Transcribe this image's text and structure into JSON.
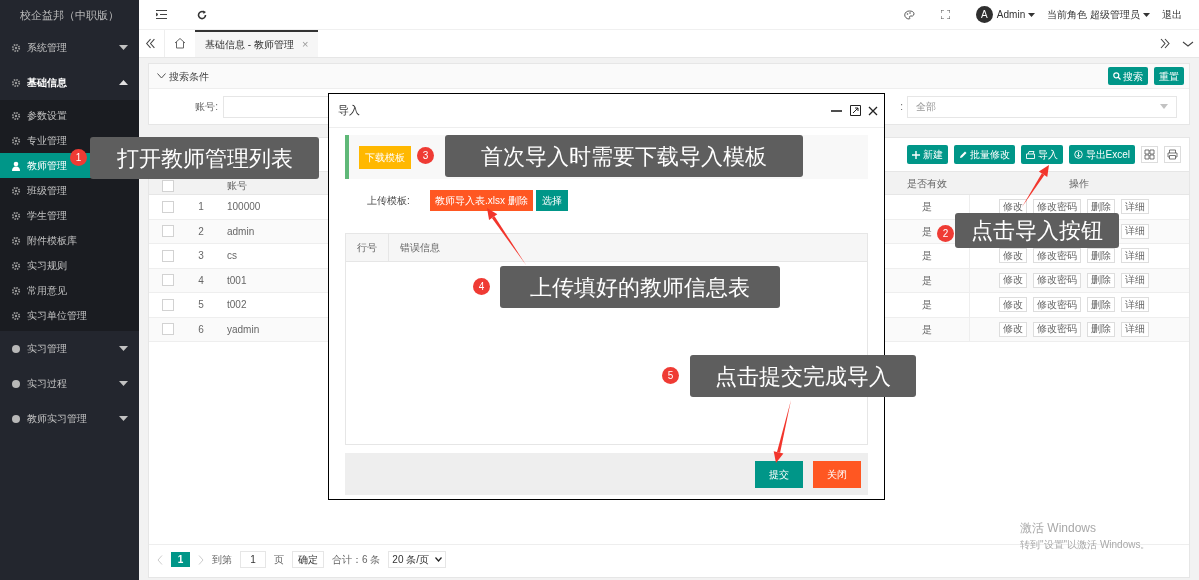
{
  "sidebar": {
    "title": "校企益邦（中职版）",
    "items": [
      {
        "label": "系统管理",
        "kind": "gear",
        "expanded": false
      },
      {
        "label": "基础信息",
        "kind": "gear",
        "expanded": true,
        "children": [
          {
            "label": "参数设置",
            "kind": "gear",
            "selected": false
          },
          {
            "label": "专业管理",
            "kind": "gear",
            "selected": false
          },
          {
            "label": "教师管理",
            "kind": "user",
            "selected": true
          },
          {
            "label": "班级管理",
            "kind": "gear",
            "selected": false
          },
          {
            "label": "学生管理",
            "kind": "gear",
            "selected": false
          },
          {
            "label": "附件模板库",
            "kind": "gear",
            "selected": false
          },
          {
            "label": "实习规则",
            "kind": "gear",
            "selected": false
          },
          {
            "label": "常用意见",
            "kind": "gear",
            "selected": false
          },
          {
            "label": "实习单位管理",
            "kind": "gear",
            "selected": false
          }
        ]
      },
      {
        "label": "实习管理",
        "kind": "dot",
        "expanded": false
      },
      {
        "label": "实习过程",
        "kind": "dot",
        "expanded": false
      },
      {
        "label": "教师实习管理",
        "kind": "dot",
        "expanded": false
      }
    ]
  },
  "top_bar": {
    "avatar": "A",
    "user": "Admin",
    "role": "当前角色 超级管理员",
    "logout": "退出"
  },
  "tabs": [
    {
      "label": "基础信息 - 教师管理",
      "selected": true,
      "close": "×"
    }
  ],
  "search": {
    "title": "搜索条件",
    "buttons": [
      {
        "label": "搜索",
        "kind": "search"
      },
      {
        "label": "重置",
        "kind": "plain"
      }
    ],
    "account_label": "账号:",
    "status_label": ":",
    "status_select": "全部"
  },
  "toolbar": [
    {
      "label": "新建",
      "kind": "plus"
    },
    {
      "label": "批量修改",
      "kind": "pencil"
    },
    {
      "label": "导入",
      "kind": "import"
    },
    {
      "label": "导出Excel",
      "kind": "export"
    }
  ],
  "table": {
    "all_checked": false,
    "columns": [
      "账号",
      "是否有效",
      "操作"
    ],
    "rows": [
      {
        "checked": false,
        "no": "1",
        "account": "100000",
        "valid": "是",
        "ops": [
          "修改",
          "修改密码",
          "删除",
          "详细"
        ]
      },
      {
        "checked": false,
        "no": "2",
        "account": "admin",
        "valid": "是",
        "ops": [
          "详细"
        ]
      },
      {
        "checked": false,
        "no": "3",
        "account": "cs",
        "valid": "是",
        "ops": [
          "修改",
          "修改密码",
          "删除",
          "详细"
        ]
      },
      {
        "checked": false,
        "no": "4",
        "account": "t001",
        "valid": "是",
        "ops": [
          "修改",
          "修改密码",
          "删除",
          "详细"
        ]
      },
      {
        "checked": false,
        "no": "5",
        "account": "t002",
        "valid": "是",
        "ops": [
          "修改",
          "修改密码",
          "删除",
          "详细"
        ]
      },
      {
        "checked": false,
        "no": "6",
        "account": "yadmin",
        "valid": "是",
        "ops": [
          "修改",
          "修改密码",
          "删除",
          "详细"
        ]
      }
    ]
  },
  "pagination": {
    "page": "1",
    "goto_label": "到第",
    "page_input": "1",
    "page_suffix": "页",
    "confirm": "确定",
    "total": "合计：6 条",
    "per_page": "20 条/页"
  },
  "modal": {
    "title": "导入",
    "download_button": "下载模板",
    "upload_label": "上传模板:",
    "file_button": "教师导入表.xlsx 删除",
    "choose_button": "选择",
    "columns": [
      "行号",
      "错误信息"
    ],
    "buttons": [
      {
        "label": "提交",
        "kind": "primary"
      },
      {
        "label": "关闭",
        "kind": "danger"
      }
    ]
  },
  "callouts": [
    {
      "number": "1",
      "text": "打开教师管理列表"
    },
    {
      "number": "2",
      "text": "点击导入按钮"
    },
    {
      "number": "3",
      "text": "首次导入时需要下载导入模板"
    },
    {
      "number": "4",
      "text": "上传填好的教师信息表"
    },
    {
      "number": "5",
      "text": "点击提交完成导入"
    }
  ],
  "os_notice": {
    "title": "激活 Windows",
    "text": "转到\"设置\"以激活 Windows。"
  }
}
